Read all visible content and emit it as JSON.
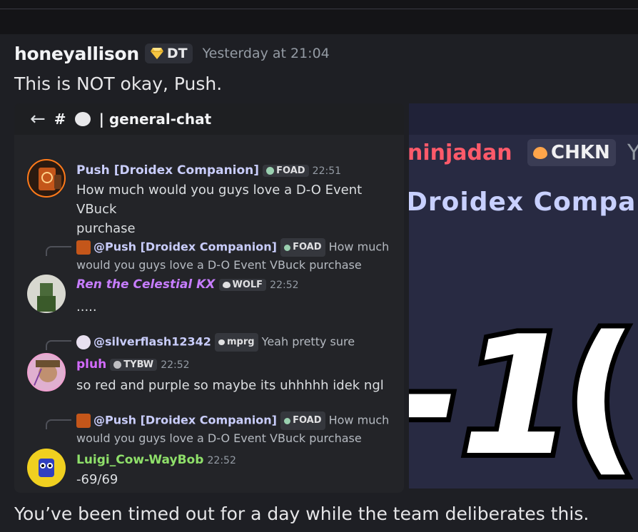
{
  "message": {
    "author": "honeyallison",
    "tag": "DT",
    "timestamp": "Yesterday at 21:04",
    "text": "This is NOT okay, Push.",
    "followup": "You’ve been timed out for a day while the team deliberates this."
  },
  "screenshot1": {
    "back_icon": "←",
    "channel_hash": "#",
    "channel_name": "| general-chat",
    "messages": [
      {
        "author": "Push [Droidex Companion]",
        "author_color": "#c9cdfb",
        "tag": "FOAD",
        "time": "22:51",
        "text_line1": "How much would you guys love a  D-O Event VBuck",
        "text_line2": "purchase"
      },
      {
        "reply_mention": "@Push [Droidex Companion]",
        "reply_tag": "FOAD",
        "reply_text1": "How much",
        "reply_text2": "would you guys love a  D-O Event VBuck purchase",
        "author": "Ren the Celestial KX",
        "author_color": "#c77dff",
        "tag": "WOLF",
        "time": "22:52",
        "text": "....."
      },
      {
        "reply_mention": "@silverflash12342",
        "reply_tag": "mprg",
        "reply_text1": "Yeah pretty sure",
        "author": "pluh",
        "author_color": "#d36bff",
        "tag": "TYBW",
        "time": "22:52",
        "text": "so red and purple so maybe its uhhhhh idek ngl"
      },
      {
        "reply_mention": "@Push [Droidex Companion]",
        "reply_tag": "FOAD",
        "reply_text1": "How much",
        "reply_text2": "would you guys love a  D-O Event VBuck purchase",
        "author": "Luigi_Cow-WayBob",
        "author_color": "#8fe06a",
        "tag": "",
        "time": "22:52",
        "text": "-69/69"
      }
    ]
  },
  "screenshot2": {
    "name_fragment": "ninjadan",
    "tag": "CHKN",
    "trailing_char": "Y",
    "companion_fragment": "Droidex Compan",
    "big_text": "-1"
  },
  "colors": {
    "background": "#1e1f24",
    "accent_red": "#ff5a6a",
    "accent_purple": "#c77dff",
    "accent_green": "#8fe06a"
  }
}
